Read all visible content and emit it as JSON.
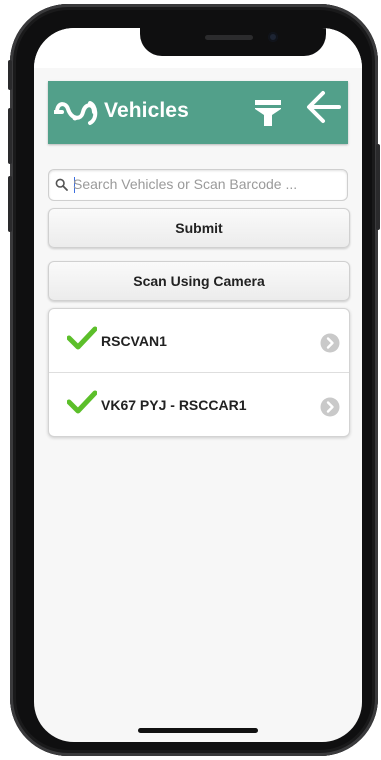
{
  "header": {
    "title": "Vehicles",
    "logo_icon": "connector-logo-icon",
    "filter_icon": "filter-icon",
    "back_icon": "back-arrow-icon",
    "color": "#52a08a"
  },
  "search": {
    "placeholder": "Search Vehicles or Scan Barcode ...",
    "value": "",
    "icon": "search-icon"
  },
  "actions": {
    "submit_label": "Submit",
    "scan_label": "Scan Using Camera"
  },
  "vehicles": [
    {
      "label": "RSCVAN1",
      "status_icon": "check-icon",
      "nav_icon": "chevron-right-icon"
    },
    {
      "label": "VK67 PYJ - RSCCAR1",
      "status_icon": "check-icon",
      "nav_icon": "chevron-right-icon"
    }
  ]
}
